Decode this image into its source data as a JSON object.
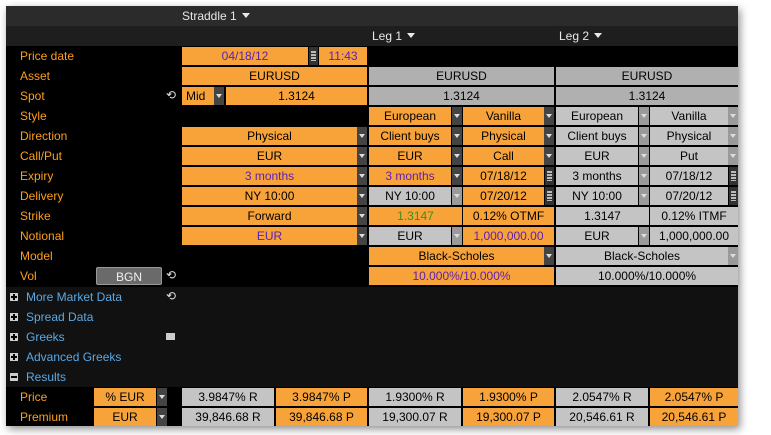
{
  "title": "Straddle 1",
  "legs": [
    "Leg 1",
    "Leg 2"
  ],
  "price_date": {
    "label": "Price date",
    "date": "04/18/12",
    "time": "11:43"
  },
  "asset": {
    "label": "Asset",
    "main": "EURUSD",
    "leg1": "EURUSD",
    "leg2": "EURUSD"
  },
  "spot": {
    "label": "Spot",
    "side": "Mid",
    "main": "1.3124",
    "leg1": "1.3124",
    "leg2": "1.3124"
  },
  "style": {
    "label": "Style",
    "leg1_exercise": "European",
    "leg1_type": "Vanilla",
    "leg2_exercise": "European",
    "leg2_type": "Vanilla"
  },
  "direction": {
    "label": "Direction",
    "main": "Physical",
    "leg1_dir": "Client buys",
    "leg1_settle": "Physical",
    "leg2_dir": "Client buys",
    "leg2_settle": "Physical"
  },
  "callput": {
    "label": "Call/Put",
    "main": "EUR",
    "leg1_ccy": "EUR",
    "leg1_type": "Call",
    "leg2_ccy": "EUR",
    "leg2_type": "Put"
  },
  "expiry": {
    "label": "Expiry",
    "main": "3 months",
    "leg1_tenor": "3 months",
    "leg1_date": "07/18/12",
    "leg2_tenor": "3 months",
    "leg2_date": "07/18/12"
  },
  "delivery": {
    "label": "Delivery",
    "main": "NY 10:00",
    "leg1_cut": "NY 10:00",
    "leg1_date": "07/20/12",
    "leg2_cut": "NY 10:00",
    "leg2_date": "07/20/12"
  },
  "strike": {
    "label": "Strike",
    "main": "Forward",
    "leg1_value": "1.3147",
    "leg1_moneyness": "0.12% OTMF",
    "leg2_value": "1.3147",
    "leg2_moneyness": "0.12% ITMF"
  },
  "notional": {
    "label": "Notional",
    "main": "EUR",
    "leg1_ccy": "EUR",
    "leg1_amount": "1,000,000.00",
    "leg2_ccy": "EUR",
    "leg2_amount": "1,000,000.00"
  },
  "model": {
    "label": "Model",
    "leg1": "Black-Scholes",
    "leg2": "Black-Scholes"
  },
  "vol": {
    "label": "Vol",
    "source": "BGN",
    "leg1": "10.000%/10.000%",
    "leg2": "10.000%/10.000%"
  },
  "sections": [
    "More Market Data",
    "Spread Data",
    "Greeks",
    "Advanced Greeks",
    "Results"
  ],
  "results": {
    "price": {
      "label": "Price",
      "unit": "% EUR",
      "values": [
        "3.9847% R",
        "3.9847% P",
        "1.9300% R",
        "1.9300% P",
        "2.0547% R",
        "2.0547% P"
      ]
    },
    "premium": {
      "label": "Premium",
      "unit": "EUR",
      "values": [
        "39,846.68 R",
        "39,846.68 P",
        "19,300.07 R",
        "19,300.07 P",
        "20,546.61 R",
        "20,546.61 P"
      ]
    }
  }
}
